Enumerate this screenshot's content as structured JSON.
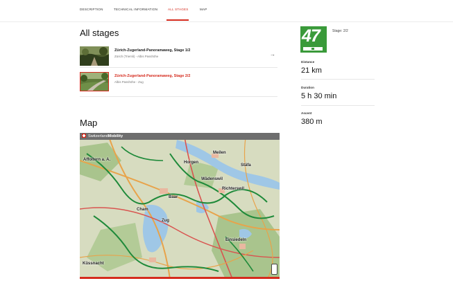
{
  "tabs": [
    {
      "label": "DESCRIPTION",
      "active": false
    },
    {
      "label": "TECHNICAL INFORMATION",
      "active": false
    },
    {
      "label": "ALL STAGES",
      "active": true
    },
    {
      "label": "MAP",
      "active": false
    }
  ],
  "all_stages": {
    "heading": "All stages",
    "stages": [
      {
        "title": "Zürich-Zugerland-Panoramaweg, Stage 1/2",
        "subtitle": "Zürich (Triemli) - Albis Passhöhe",
        "current": false
      },
      {
        "title": "Zürich-Zugerland-Panoramaweg, Stage 2/2",
        "subtitle": "Albis Passhöhe - Zug",
        "current": true
      }
    ]
  },
  "map": {
    "heading": "Map",
    "brand_prefix": "Switzerland",
    "brand_suffix": "Mobility",
    "labels": [
      "Meilen",
      "Wädenswil",
      "Richterswil",
      "Affoltern a. A.",
      "Stäfa",
      "Cham",
      "Baar",
      "Zug",
      "Einsiedeln",
      "Horgen",
      "Küssnacht"
    ]
  },
  "route_info": {
    "badge_number": "47",
    "stage_label": "Stage: 2/2",
    "stats": [
      {
        "label": "Distance",
        "value": "21 km"
      },
      {
        "label": "Duration",
        "value": "5 h 30 min"
      },
      {
        "label": "Ascent",
        "value": "380 m"
      }
    ]
  },
  "colors": {
    "accent": "#d52b1e",
    "route_green": "#3a9a3a",
    "map_header": "#6e6e6e"
  }
}
